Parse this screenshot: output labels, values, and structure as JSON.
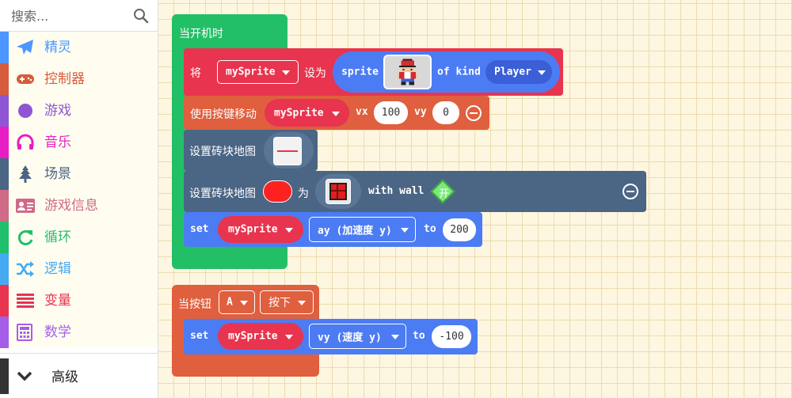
{
  "search": {
    "placeholder": "搜索..."
  },
  "categories": [
    {
      "label": "精灵",
      "color": "#4c97ff",
      "icon": "paper-plane-icon"
    },
    {
      "label": "控制器",
      "color": "#d65c3c",
      "icon": "gamepad-icon"
    },
    {
      "label": "游戏",
      "color": "#8e56d4",
      "icon": "circle-icon"
    },
    {
      "label": "音乐",
      "color": "#e71ec4",
      "icon": "headphones-icon"
    },
    {
      "label": "场景",
      "color": "#4b6584",
      "icon": "tree-icon"
    },
    {
      "label": "游戏信息",
      "color": "#cf6a87",
      "icon": "id-card-icon"
    },
    {
      "label": "循环",
      "color": "#20bf6b",
      "icon": "refresh-icon"
    },
    {
      "label": "逻辑",
      "color": "#45aaf2",
      "icon": "shuffle-icon"
    },
    {
      "label": "变量",
      "color": "#e8344e",
      "icon": "list-icon"
    },
    {
      "label": "数学",
      "color": "#a55eea",
      "icon": "calculator-icon"
    }
  ],
  "advanced": {
    "label": "高级",
    "icon": "chevron-down-icon"
  },
  "colors": {
    "loops": "#23bf66",
    "variables": "#e8344e",
    "controller": "#df5f3e",
    "scene": "#4b6584",
    "sprites": "#4c7cf3",
    "dropdown_dark": "#3a5fd6"
  },
  "blocks": {
    "on_start": {
      "label": "当开机时",
      "set_var": {
        "label": "将",
        "var": "mySprite",
        "to": "设为",
        "sprite_label": "sprite",
        "of_kind": "of kind",
        "kind": "Player"
      },
      "move": {
        "label": "使用按键移动",
        "var": "mySprite",
        "vx_label": "vx",
        "vx": "100",
        "vy_label": "vy",
        "vy": "0"
      },
      "tilemap": {
        "label": "设置砖块地图"
      },
      "set_tile": {
        "label": "设置砖块地图",
        "as": "为",
        "with_wall": "with wall",
        "toggle": "开"
      },
      "set_ay": {
        "label": "set",
        "var": "mySprite",
        "prop": "ay (加速度 y)",
        "to": "to",
        "value": "200"
      }
    },
    "on_button": {
      "label": "当按钮",
      "button": "A",
      "event": "按下",
      "set_vy": {
        "label": "set",
        "var": "mySprite",
        "prop": "vy (速度 y)",
        "to": "to",
        "value": "-100"
      }
    }
  }
}
